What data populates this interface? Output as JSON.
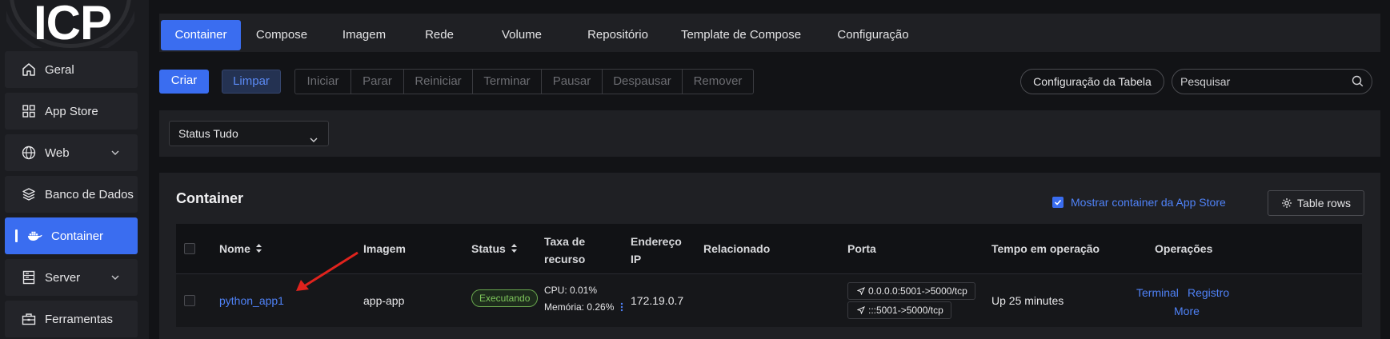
{
  "app": {
    "logo_text": "ICP"
  },
  "sidebar": {
    "items": [
      {
        "label": "Geral",
        "icon": "home-icon"
      },
      {
        "label": "App Store",
        "icon": "grid-icon"
      },
      {
        "label": "Web",
        "icon": "globe-icon",
        "expandable": true
      },
      {
        "label": "Banco de Dados",
        "icon": "layers-icon"
      },
      {
        "label": "Container",
        "icon": "docker-icon",
        "active": true
      },
      {
        "label": "Server",
        "icon": "server-icon",
        "expandable": true
      },
      {
        "label": "Ferramentas",
        "icon": "toolbox-icon"
      }
    ]
  },
  "tabs": [
    "Container",
    "Compose",
    "Imagem",
    "Rede",
    "Volume",
    "Repositório",
    "Template de Compose",
    "Configuração"
  ],
  "toolbar": {
    "create": "Criar",
    "clean": "Limpar",
    "actions": [
      "Iniciar",
      "Parar",
      "Reiniciar",
      "Terminar",
      "Pausar",
      "Despausar",
      "Remover"
    ],
    "table_config": "Configuração da Tabela",
    "search_placeholder": "Pesquisar"
  },
  "filter": {
    "status_label": "Status",
    "status_value": "Tudo"
  },
  "panel": {
    "title": "Container",
    "show_appstore_label": "Mostrar container da App Store",
    "show_appstore_checked": true,
    "table_rows_label": "Table rows"
  },
  "table": {
    "headers": {
      "name": "Nome",
      "image": "Imagem",
      "status": "Status",
      "resource_1": "Taxa de",
      "resource_2": "recurso",
      "ip_1": "Endereço",
      "ip_2": "IP",
      "related": "Relacionado",
      "port": "Porta",
      "uptime": "Tempo em operação",
      "ops": "Operações"
    },
    "rows": [
      {
        "name": "python_app1",
        "image": "app-app",
        "status": "Executando",
        "cpu": "CPU: 0.01%",
        "memory": "Memória: 0.26%",
        "ip": "172.19.0.7",
        "ports": [
          "0.0.0.0:5001->5000/tcp",
          ":::5001->5000/tcp"
        ],
        "uptime": "Up 25 minutes",
        "ops": [
          "Terminal",
          "Registro",
          "More"
        ]
      }
    ]
  },
  "colors": {
    "accent": "#3a6df0",
    "status_running": "#7fc75c",
    "annotation_arrow": "#e0231d"
  }
}
